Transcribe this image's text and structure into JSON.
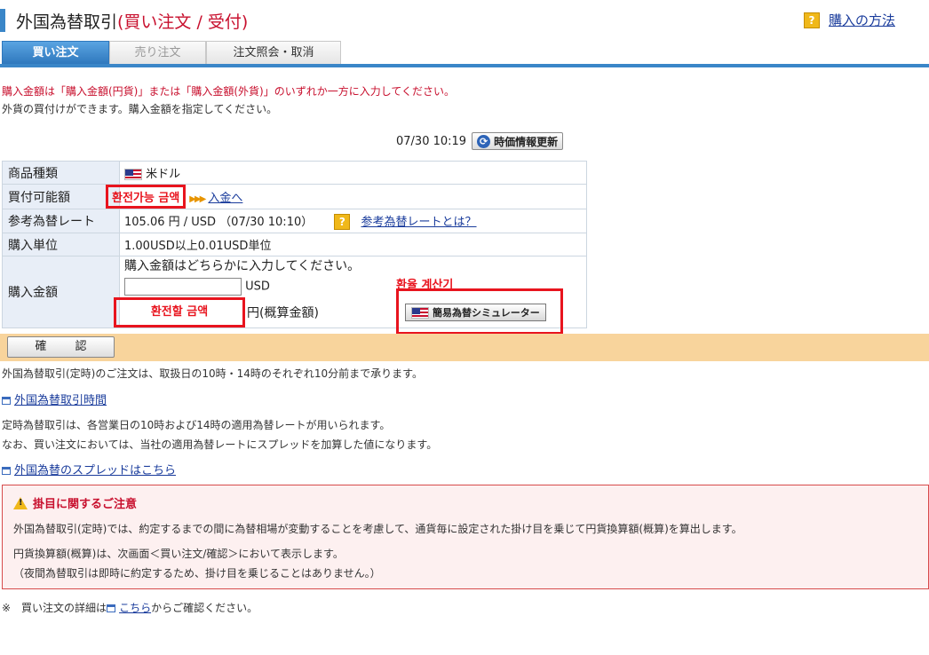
{
  "header": {
    "title": "外国為替取引",
    "subtitle": "(買い注文 / 受付)",
    "help_icon": "question-icon",
    "help_link": "購入の方法"
  },
  "tabs": [
    {
      "label": "買い注文",
      "state": "active"
    },
    {
      "label": "売り注文",
      "state": "disabled"
    },
    {
      "label": "注文照会・取消",
      "state": "normal"
    }
  ],
  "notices": {
    "red": "購入金額は「購入金額(円貨)」または「購入金額(外貨)」のいずれか一方に入力してください。",
    "normal": "外貨の買付けができます。購入金額を指定してください。"
  },
  "rate_refresh": {
    "timestamp": "07/30 10:19",
    "button_label": "時価情報更新"
  },
  "form": {
    "product_type": {
      "label": "商品種類",
      "value": "米ドル"
    },
    "available_amount": {
      "label": "買付可能額",
      "value": "환전가능 금액",
      "deposit_link": "入金へ"
    },
    "reference_rate": {
      "label": "参考為替レート",
      "value": "105.06 円 / USD （07/30 10:10）",
      "link": "参考為替レートとは？"
    },
    "purchase_unit": {
      "label": "購入単位",
      "value": "1.00USD以上0.01USD単位"
    },
    "purchase_amount": {
      "label": "購入金額",
      "instruction": "購入金額はどちらかに入力してください。",
      "usd_value": "",
      "usd_unit": "USD",
      "jpy_box_label": "환전할 금액",
      "jpy_unit": "円(概算金額)"
    }
  },
  "simulator": {
    "label": "환율 계산기",
    "button_label": "簡易為替シミュレーター"
  },
  "confirm_button": "確 認",
  "info": {
    "line1": "外国為替取引(定時)のご注文は、取扱日の10時・14時のそれぞれ10分前まで承ります。",
    "link1": "外国為替取引時間",
    "line2": "定時為替取引は、各営業日の10時および14時の適用為替レートが用いられます。",
    "line3": "なお、買い注文においては、当社の適用為替レートにスプレッドを加算した値になります。",
    "link2": "外国為替のスプレッドはこちら"
  },
  "caution": {
    "title": "掛目に関するご注意",
    "line1": "外国為替取引(定時)では、約定するまでの間に為替相場が変動することを考慮して、通貨毎に設定された掛け目を乗じて円貨換算額(概算)を算出します。",
    "line2": "円貨換算額(概算)は、次画面＜買い注文/確認＞において表示します。",
    "line3": "（夜間為替取引は即時に約定するため、掛け目を乗じることはありません。）"
  },
  "footnote": {
    "prefix": "※　買い注文の詳細は",
    "link": "こちら",
    "suffix": "からご確認ください。"
  },
  "colors": {
    "accent_blue": "#3a86c8",
    "alert_red": "#c8102e",
    "annotation_red": "#e8141e",
    "confirm_bar": "#f8d49c"
  }
}
